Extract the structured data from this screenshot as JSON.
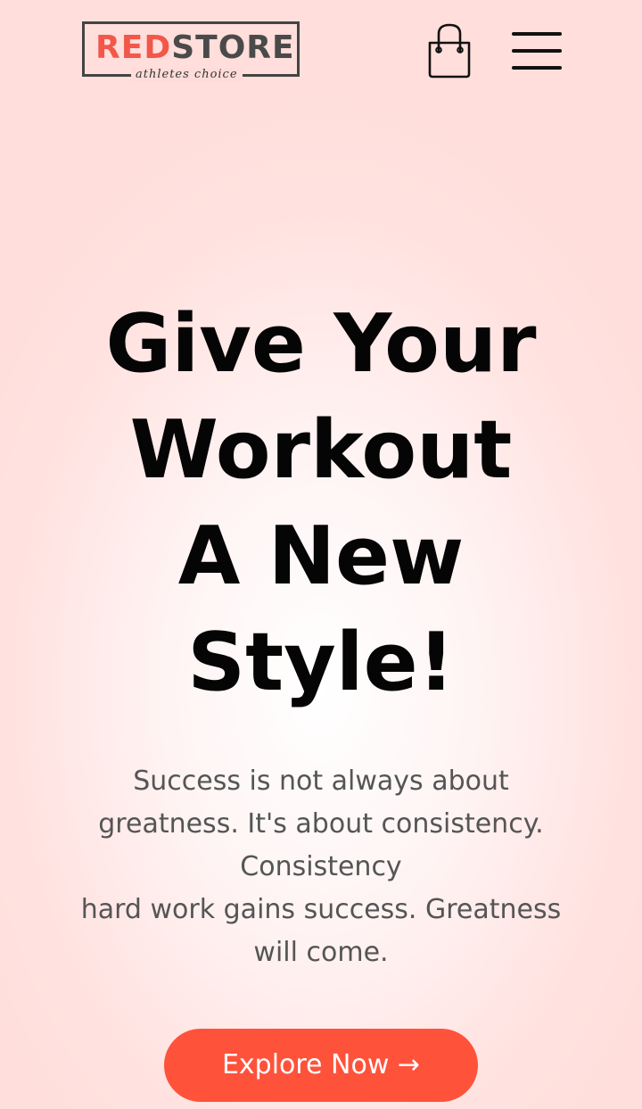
{
  "navbar": {
    "logo": {
      "red_text": "RED",
      "dark_text": "STORE",
      "tagline": "athletes choice"
    },
    "icons": {
      "cart": "shopping-bag-icon",
      "menu": "hamburger-menu-icon"
    }
  },
  "hero": {
    "title_lines": [
      "Give Your",
      "Workout",
      "A New",
      "Style!"
    ],
    "description_lines": [
      "Success is not always about",
      "greatness. It's about consistency.",
      "Consistency",
      "hard work gains success. Greatness",
      "will come."
    ],
    "cta_label": "Explore Now →"
  },
  "colors": {
    "accent": "#ff523b",
    "logo_red": "#f2574a",
    "title": "#050505",
    "body_text": "#555555",
    "background": "#ffe3e1"
  }
}
